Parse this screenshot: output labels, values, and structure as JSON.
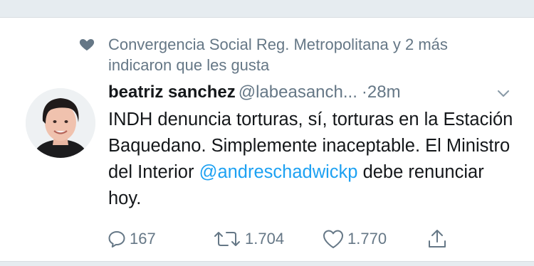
{
  "social_context": {
    "icon": "heart-icon",
    "text": "Convergencia Social Reg. Metropolitana y 2 más indicaron que les gusta"
  },
  "tweet": {
    "author_name": "beatriz sanchez",
    "author_handle": "@labeasanch...",
    "separator": "·",
    "timestamp": "28m",
    "text_before_link": "INDH denuncia torturas, sí, torturas en la Estación Baquedano. Simplemente inaceptable. El Ministro del Interior ",
    "mention": "@andreschadwickp",
    "text_after_link": " debe renunciar hoy."
  },
  "actions": {
    "reply_count": "167",
    "retweet_count": "1.704",
    "like_count": "1.770"
  },
  "colors": {
    "secondary_text": "#657786",
    "link": "#1da1f2",
    "primary_text": "#14171a"
  }
}
